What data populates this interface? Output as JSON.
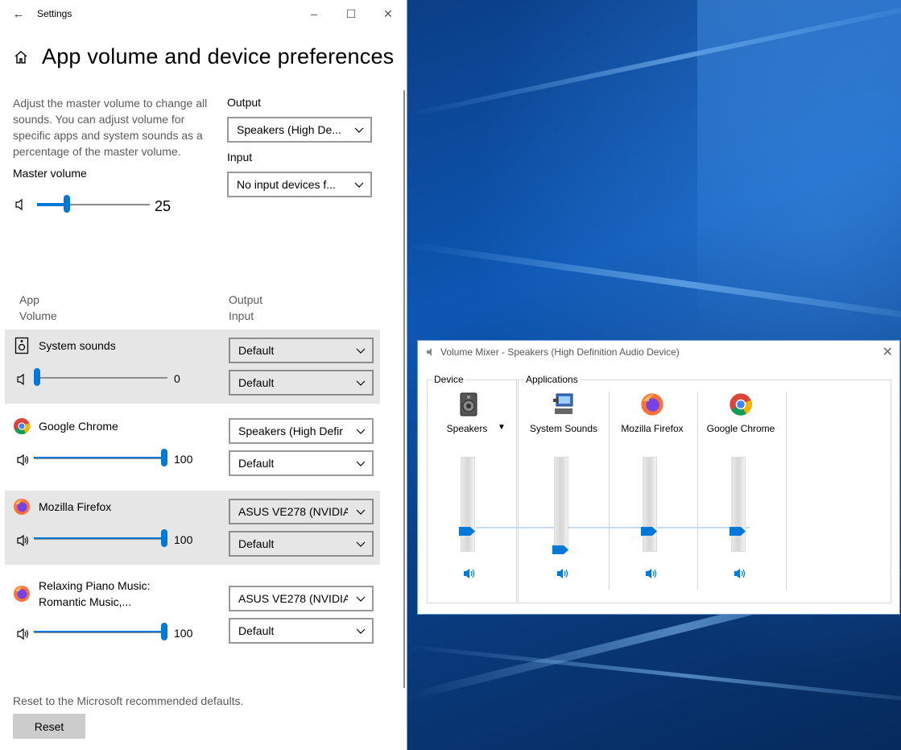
{
  "settings": {
    "window_title": "Settings",
    "page_title": "App volume and device preferences",
    "description": "Adjust the master volume to change all sounds. You can adjust volume for specific apps and system sounds as a percentage of the master volume.",
    "master_volume_label": "Master volume",
    "master_volume": 25,
    "output_label": "Output",
    "output_value": "Speakers (High De...",
    "input_label": "Input",
    "input_value": "No input devices f...",
    "col_app": "App",
    "col_volume": "Volume",
    "col_output": "Output",
    "col_input": "Input",
    "apps": [
      {
        "name": "System sounds",
        "volume": 0,
        "output": "Default",
        "input": "Default",
        "icon": "speaker-box-icon"
      },
      {
        "name": "Google Chrome",
        "volume": 100,
        "output": "Speakers (High Defir",
        "input": "Default",
        "icon": "chrome-icon"
      },
      {
        "name": "Mozilla Firefox",
        "volume": 100,
        "output": "ASUS VE278 (NVIDIA",
        "input": "Default",
        "icon": "firefox-icon"
      },
      {
        "name": "Relaxing Piano Music: Romantic Music,...",
        "volume": 100,
        "output": "ASUS VE278 (NVIDIA",
        "input": "Default",
        "icon": "firefox-icon"
      }
    ],
    "reset_note": "Reset to the Microsoft recommended defaults.",
    "reset_label": "Reset"
  },
  "mixer": {
    "title": "Volume Mixer - Speakers (High Definition Audio Device)",
    "device_legend": "Device",
    "applications_legend": "Applications",
    "device_name": "Speakers",
    "channels": [
      {
        "name": "System Sounds",
        "level": 0,
        "icon": "system-sounds-icon"
      },
      {
        "name": "Mozilla Firefox",
        "level": 25,
        "icon": "firefox-icon"
      },
      {
        "name": "Google Chrome",
        "level": 25,
        "icon": "chrome-icon"
      }
    ],
    "device_level": 25
  },
  "colors": {
    "accent": "#0078d7",
    "highlight_row": "#e6e6e6"
  }
}
